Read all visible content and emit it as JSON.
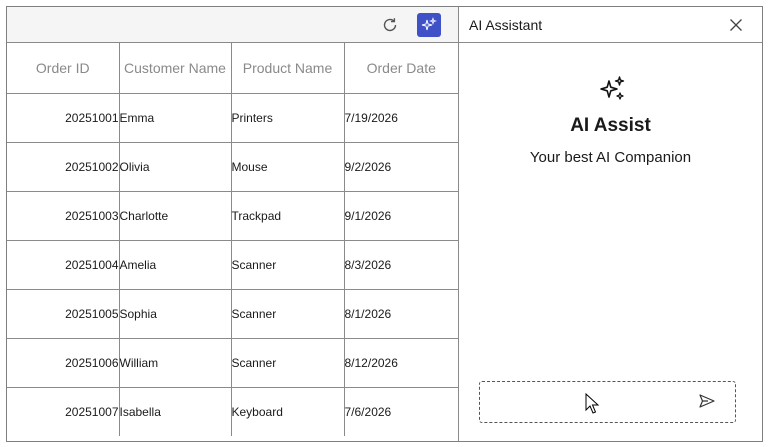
{
  "grid": {
    "columns": [
      "Order ID",
      "Customer Name",
      "Product Name",
      "Order Date"
    ],
    "rows": [
      {
        "order_id": "20251001",
        "customer": "Emma",
        "product": "Printers",
        "date": "7/19/2026"
      },
      {
        "order_id": "20251002",
        "customer": "Olivia",
        "product": "Mouse",
        "date": "9/2/2026"
      },
      {
        "order_id": "20251003",
        "customer": "Charlotte",
        "product": "Trackpad",
        "date": "9/1/2026"
      },
      {
        "order_id": "20251004",
        "customer": "Amelia",
        "product": "Scanner",
        "date": "8/3/2026"
      },
      {
        "order_id": "20251005",
        "customer": "Sophia",
        "product": "Scanner",
        "date": "8/1/2026"
      },
      {
        "order_id": "20251006",
        "customer": "William",
        "product": "Scanner",
        "date": "8/12/2026"
      },
      {
        "order_id": "20251007",
        "customer": "Isabella",
        "product": "Keyboard",
        "date": "7/6/2026"
      }
    ]
  },
  "toolbar": {
    "icons": [
      "refresh-icon",
      "ai-sparkle-icon"
    ],
    "ai_button_color": "#3f51c6"
  },
  "assistant": {
    "title": "AI Assistant",
    "heading": "AI Assist",
    "subtitle": "Your best AI Companion",
    "prompt_value": "",
    "icons": [
      "close-icon",
      "sparkle-icon",
      "send-icon"
    ]
  }
}
